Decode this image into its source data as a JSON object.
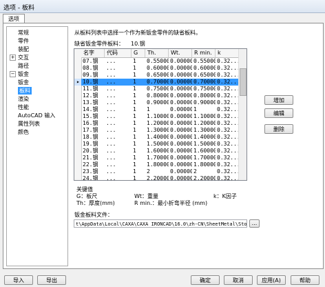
{
  "window": {
    "title": "选项 - 板料"
  },
  "tabs": [
    {
      "label": "选项"
    }
  ],
  "tree": [
    {
      "label": "常规",
      "level": 1,
      "expander": ""
    },
    {
      "label": "零件",
      "level": 1,
      "expander": ""
    },
    {
      "label": "装配",
      "level": 1,
      "expander": ""
    },
    {
      "label": "交互",
      "level": 1,
      "expander": "+"
    },
    {
      "label": "路径",
      "level": 1,
      "expander": ""
    },
    {
      "label": "钣金",
      "level": 1,
      "expander": "−"
    },
    {
      "label": "钣金",
      "level": 2,
      "expander": ""
    },
    {
      "label": "板料",
      "level": 2,
      "expander": "",
      "selected": true
    },
    {
      "label": "渲染",
      "level": 1,
      "expander": ""
    },
    {
      "label": "性能",
      "level": 1,
      "expander": ""
    },
    {
      "label": "AutoCAD 输入",
      "level": 1,
      "expander": ""
    },
    {
      "label": "属性列表",
      "level": 1,
      "expander": ""
    },
    {
      "label": "颜色",
      "level": 1,
      "expander": ""
    }
  ],
  "main": {
    "instruction": "从板料列表中选择一个作为新钣金零件的缺省板料。",
    "default_label": "缺省钣金零件板料：",
    "default_value": "10.钢"
  },
  "grid": {
    "columns": [
      "名字",
      "代码",
      "G",
      "Th.",
      "Wt.",
      "R min.",
      "k"
    ],
    "rows": [
      [
        "07.钢",
        "...",
        "1",
        "0.550000",
        "0.000001",
        "0.550000",
        "0.32..."
      ],
      [
        "08.钢",
        "...",
        "1",
        "0.600000",
        "0.000001",
        "0.600000",
        "0.32..."
      ],
      [
        "09.钢",
        "...",
        "1",
        "0.650000",
        "0.000001",
        "0.650000",
        "0.32..."
      ],
      [
        "10.钢",
        "...",
        "1",
        "0.700000",
        "0.000001",
        "0.700000",
        "0.32..."
      ],
      [
        "11.钢",
        "...",
        "1",
        "0.750000",
        "0.000001",
        "0.750000",
        "0.32..."
      ],
      [
        "12.钢",
        "...",
        "1",
        "0.800000",
        "0.000001",
        "0.800000",
        "0.32..."
      ],
      [
        "13.钢",
        "...",
        "1",
        "0.900000",
        "0.000001",
        "0.900000",
        "0.32..."
      ],
      [
        "14.钢",
        "...",
        "1",
        "1",
        "0.000001",
        "1",
        "0.32..."
      ],
      [
        "15.钢",
        "...",
        "1",
        "1.100000",
        "0.000001",
        "1.100000",
        "0.32..."
      ],
      [
        "16.钢",
        "...",
        "1",
        "1.200000",
        "0.000001",
        "1.200000",
        "0.32..."
      ],
      [
        "17.钢",
        "...",
        "1",
        "1.300000",
        "0.000001",
        "1.300000",
        "0.32..."
      ],
      [
        "18.钢",
        "...",
        "1",
        "1.400000",
        "0.000001",
        "1.400000",
        "0.32..."
      ],
      [
        "19.钢",
        "...",
        "1",
        "1.500000",
        "0.000001",
        "1.500000",
        "0.32..."
      ],
      [
        "20.钢",
        "...",
        "1",
        "1.600000",
        "0.000001",
        "1.600000",
        "0.32..."
      ],
      [
        "21.钢",
        "...",
        "1",
        "1.700000",
        "0.000001",
        "1.700000",
        "0.32..."
      ],
      [
        "22.钢",
        "...",
        "1",
        "1.800000",
        "0.000001",
        "1.800000",
        "0.32..."
      ],
      [
        "23.钢",
        "...",
        "1",
        "2",
        "0.000001",
        "2",
        "0.32..."
      ],
      [
        "24.钢",
        "...",
        "1",
        "2.200000",
        "0.000001",
        "2.200000",
        "0.32..."
      ]
    ],
    "selected_row": 3
  },
  "side_buttons": {
    "add": "增加",
    "edit": "编辑",
    "delete": "删除"
  },
  "legend": {
    "title": "关键值",
    "g": "G：板尺",
    "wt": "Wt：重量",
    "k": "k：K因子",
    "th": "Th：厚度(mm)",
    "rmin": "R min.：最小折弯半径 (mm)"
  },
  "file": {
    "label": "钣金板料文件：",
    "path": "t\\AppData\\Local\\CAXA\\CAXA IRONCAD\\16.0\\zh-CN\\SheetMetal\\Stocktbl.txt",
    "browse": "..."
  },
  "footer": {
    "import": "导入",
    "export": "导出",
    "ok": "确定",
    "cancel": "取消",
    "apply": "应用(A)",
    "help": "帮助"
  }
}
